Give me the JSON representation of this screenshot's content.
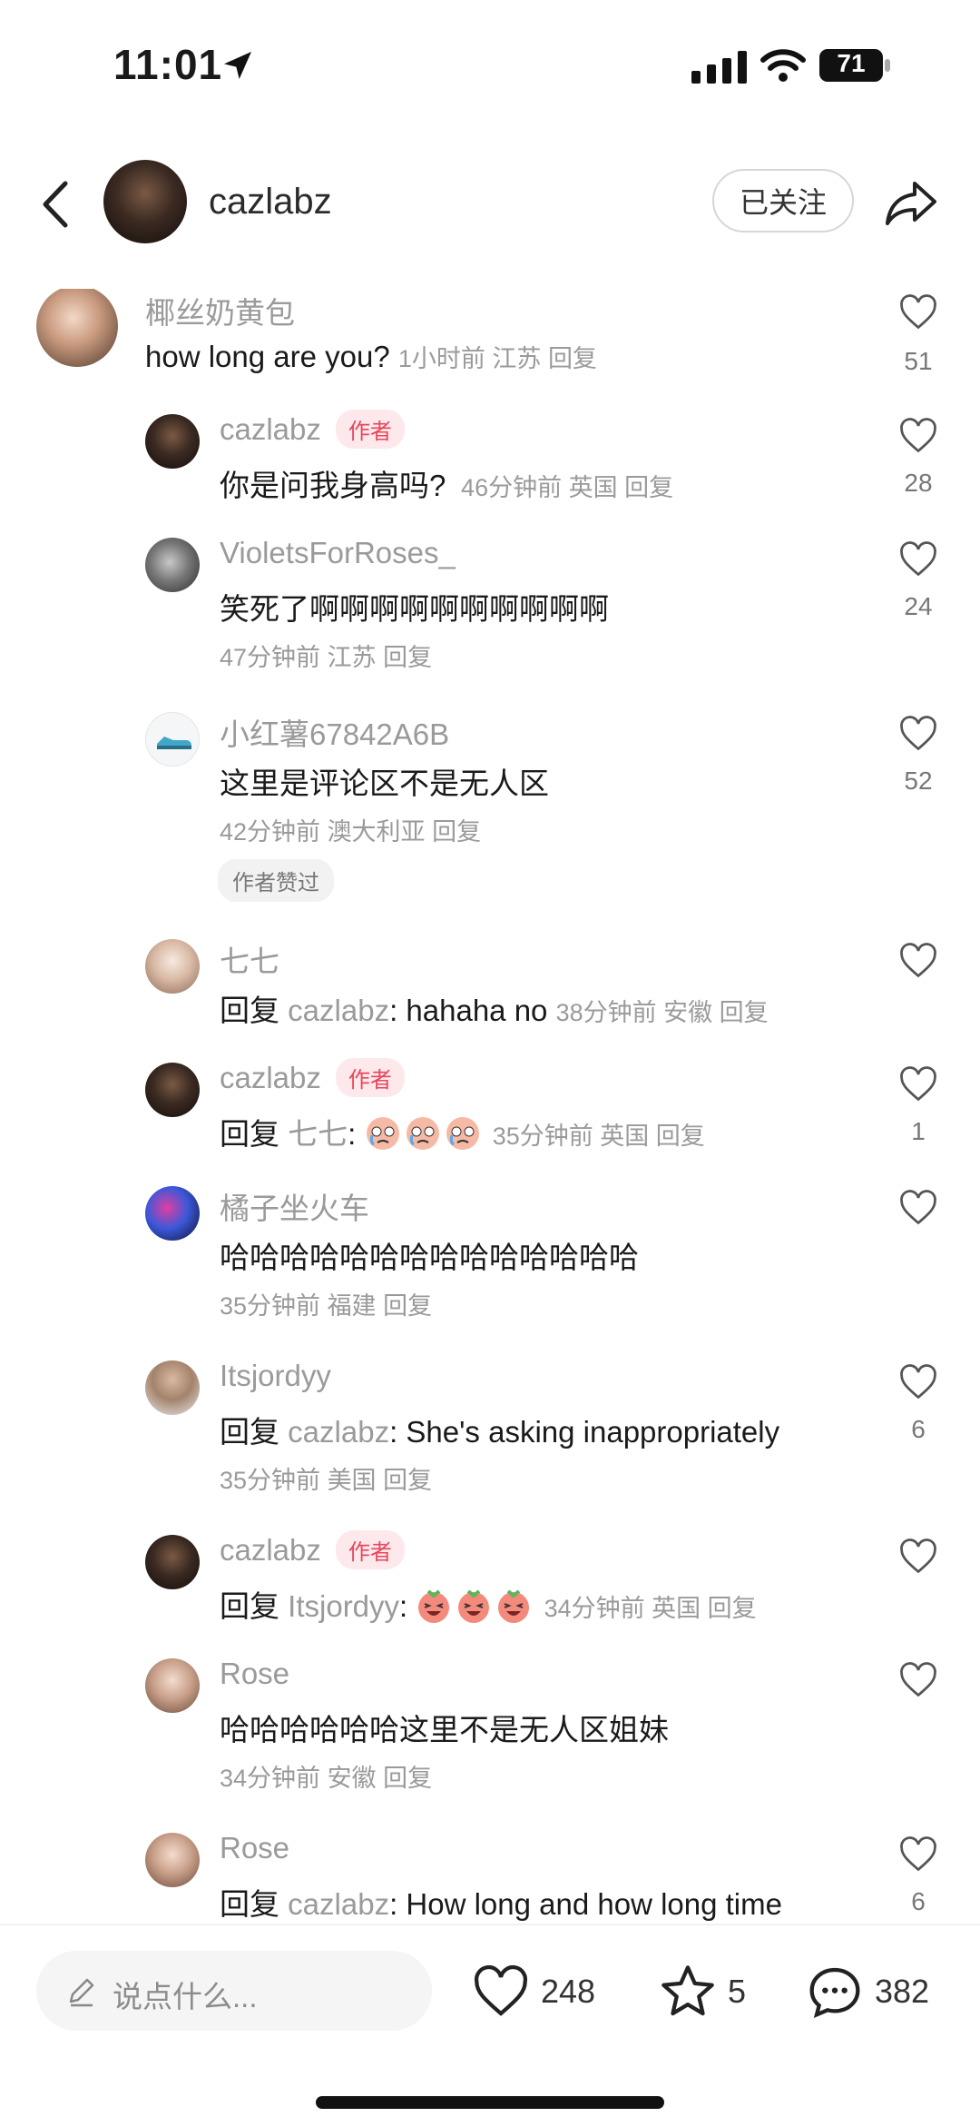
{
  "status_bar": {
    "time": "11:01",
    "battery": "71"
  },
  "header": {
    "username": "cazlabz",
    "follow_label": "已关注"
  },
  "comments": [
    {
      "user": "椰丝奶黄包",
      "text": "how long are you?",
      "time": "1小时前",
      "loc": "江苏",
      "reply": "回复",
      "likes": "51"
    },
    {
      "user": "cazlabz",
      "badge": "作者",
      "text": "你是问我身高吗?",
      "time": "46分钟前",
      "loc": "英国",
      "reply": "回复",
      "likes": "28"
    },
    {
      "user": "VioletsForRoses_",
      "text": "笑死了啊啊啊啊啊啊啊啊啊啊",
      "time": "47分钟前",
      "loc": "江苏",
      "reply": "回复",
      "likes": "24"
    },
    {
      "user": "小红薯67842A6B",
      "text": "这里是评论区不是无人区",
      "time": "42分钟前",
      "loc": "澳大利亚",
      "reply": "回复",
      "likes": "52",
      "author_liked": "作者赞过"
    },
    {
      "user": "七七",
      "prefix": "回复",
      "reply_to": "cazlabz",
      "text": "hahaha no",
      "time": "38分钟前",
      "loc": "安徽",
      "reply": "回复",
      "likes": ""
    },
    {
      "user": "cazlabz",
      "badge": "作者",
      "prefix": "回复",
      "reply_to": "七七",
      "time": "35分钟前",
      "loc": "英国",
      "reply": "回复",
      "likes": "1",
      "emoji": "crying-face"
    },
    {
      "user": "橘子坐火车",
      "text": "哈哈哈哈哈哈哈哈哈哈哈哈哈哈",
      "time": "35分钟前",
      "loc": "福建",
      "reply": "回复",
      "likes": ""
    },
    {
      "user": "Itsjordyy",
      "prefix": "回复",
      "reply_to": "cazlabz",
      "text": "She's asking inappropriately",
      "time": "35分钟前",
      "loc": "美国",
      "reply": "回复",
      "likes": "6"
    },
    {
      "user": "cazlabz",
      "badge": "作者",
      "prefix": "回复",
      "reply_to": "Itsjordyy",
      "time": "34分钟前",
      "loc": "英国",
      "reply": "回复",
      "likes": "",
      "emoji": "laughing-face"
    },
    {
      "user": "Rose",
      "text": "哈哈哈哈哈哈这里不是无人区姐妹",
      "time": "34分钟前",
      "loc": "安徽",
      "reply": "回复",
      "likes": ""
    },
    {
      "user": "Rose",
      "prefix": "回复",
      "reply_to": "cazlabz",
      "text": "How long and how long time",
      "likes": "6"
    }
  ],
  "bottom_bar": {
    "placeholder": "说点什么...",
    "likes": "248",
    "stars": "5",
    "comments": "382"
  },
  "colors": {
    "badge_bg": "#fde8ec",
    "badge_text": "#e8465a",
    "muted": "#9a9a9a"
  }
}
